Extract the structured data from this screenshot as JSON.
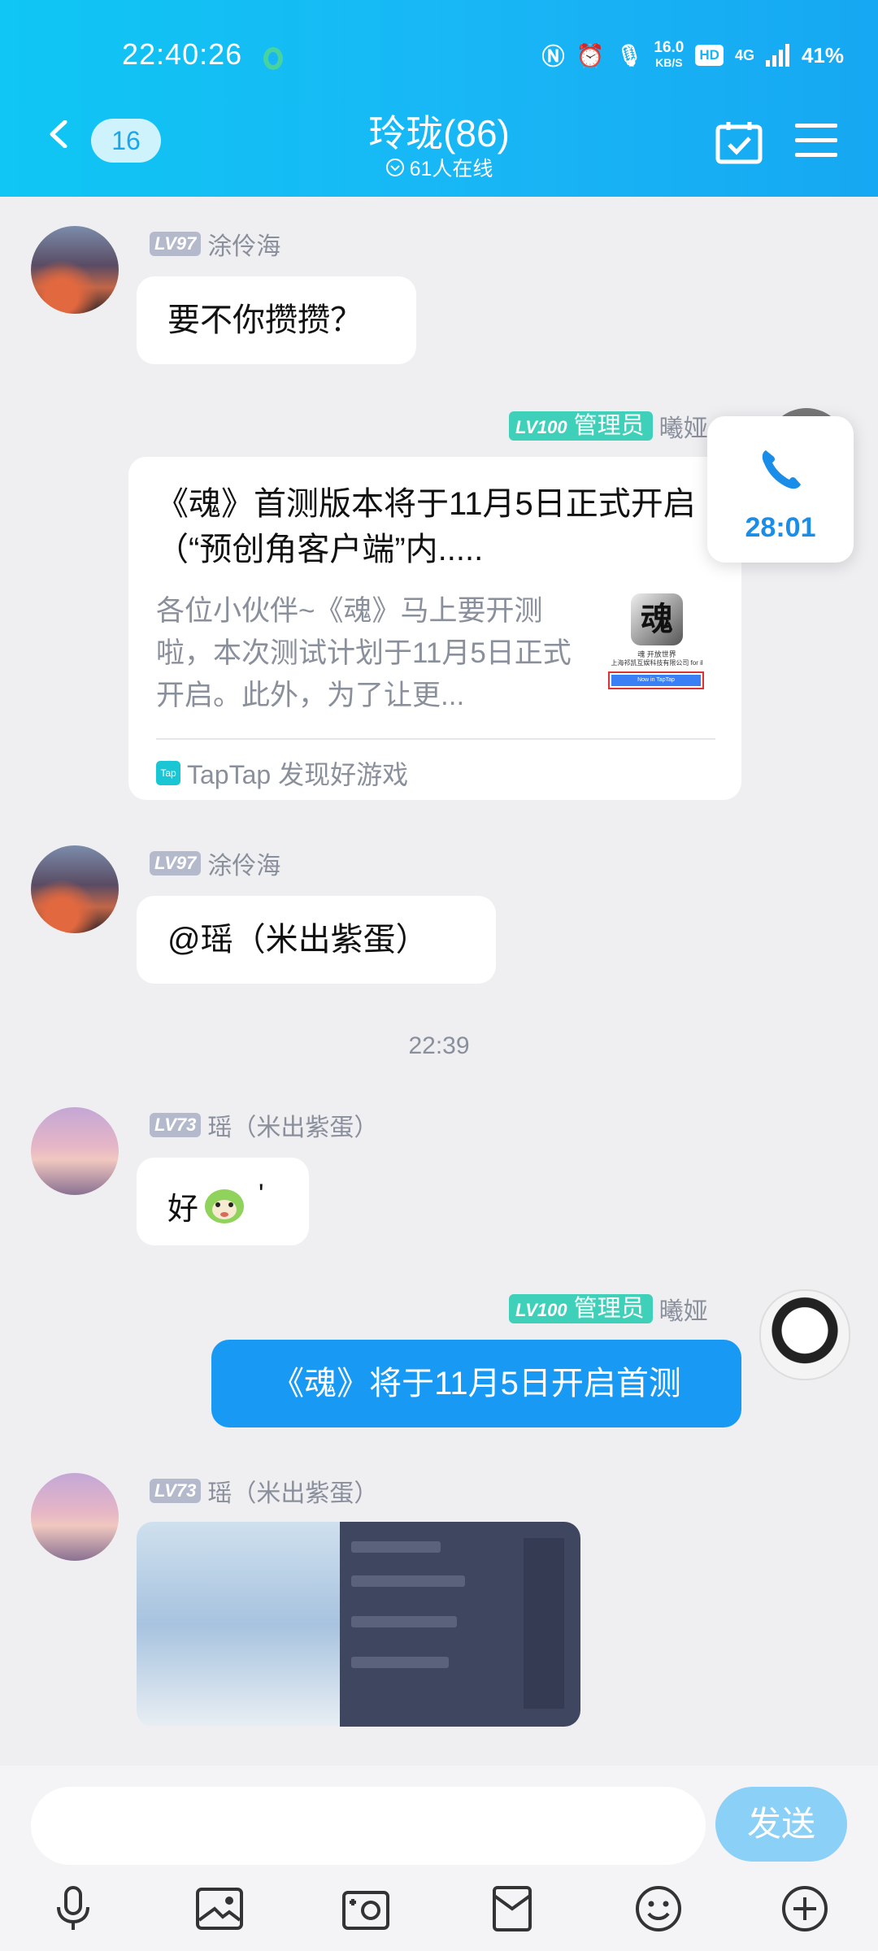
{
  "status_bar": {
    "time": "22:40:26",
    "speed_value": "16.0",
    "speed_unit": "KB/S",
    "hd": "HD",
    "net": "4G",
    "battery": "41%"
  },
  "header": {
    "unread_count": "16",
    "title": "玲珑(86)",
    "online": "61人在线"
  },
  "messages": [
    {
      "level": "LV97",
      "name": "涂伶海",
      "text": "要不你攒攒？"
    },
    {
      "admin_level": "LV100",
      "admin_role": "管理员",
      "name": "曦娅",
      "card": {
        "title": "《魂》首测版本将于11月5日正式开启（“预创角客户端”内.....",
        "desc": "各位小伙伴~《魂》马上要开测啦，本次测试计划于11月5日正式开启。此外，为了让更...",
        "source_badge": "Tap",
        "source": "TapTap 发现好游戏",
        "thumb_char": "魂",
        "thumb_line1": "魂 开放世界",
        "thumb_line2": "上海祁凯互娱科技有限公司 for il",
        "thumb_button": "Now in TapTap"
      }
    },
    {
      "level": "LV97",
      "name": "涂伶海",
      "text": "@瑶（米出紫蛋）"
    },
    {
      "level": "LV73",
      "name": "瑶（米出紫蛋）",
      "text": "好",
      "suffix": "'"
    },
    {
      "admin_level": "LV100",
      "admin_role": "管理员",
      "name": "曦娅",
      "text": "《魂》将于11月5日开启首测"
    },
    {
      "level": "LV73",
      "name": "瑶（米出紫蛋）"
    }
  ],
  "time_separator": "22:39",
  "call": {
    "duration": "28:01"
  },
  "input": {
    "placeholder": "",
    "send_label": "发送"
  },
  "toolbar": [
    "mic-icon",
    "picture-icon",
    "camera-icon",
    "red-packet-icon",
    "emoji-icon",
    "plus-icon"
  ],
  "colors": {
    "header": "#18b6f5",
    "self_bubble": "#189af4",
    "admin_tag": "#3ed0b8",
    "send_button": "#8bd0f7"
  }
}
